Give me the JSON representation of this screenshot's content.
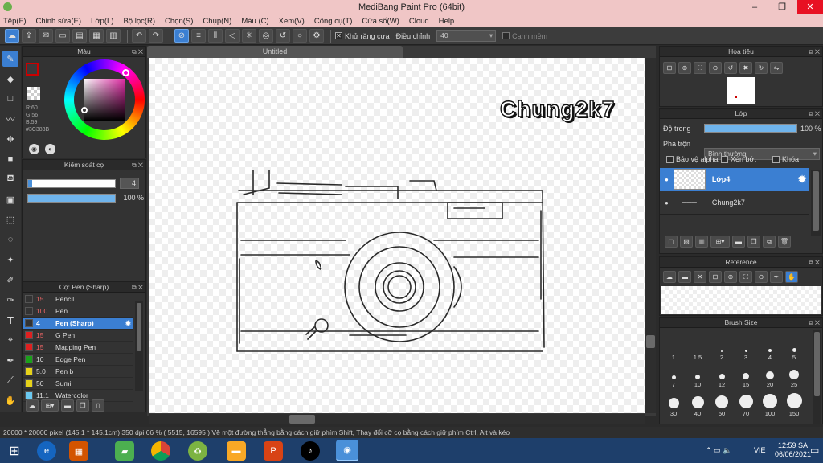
{
  "window": {
    "title": "MediBang Paint Pro (64bit)",
    "min": "–",
    "max": "❐",
    "close": "✕"
  },
  "menu": [
    "Tệp(F)",
    "Chỉnh sửa(E)",
    "Lớp(L)",
    "Bộ lọc(R)",
    "Chọn(S)",
    "Chụp(N)",
    "Màu (C)",
    "Xem(V)",
    "Công cụ(T)",
    "Cửa số(W)",
    "Cloud",
    "Help"
  ],
  "toolbar": {
    "antialias_label": "Khử răng cưa",
    "correction_label": "Điều chỉnh",
    "correction_value": "40",
    "edge_label": "Cạnh mềm"
  },
  "color_panel": {
    "title": "Màu",
    "r": "R:60",
    "g": "G:56",
    "b": "B:59",
    "hex": "#3C383B",
    "primary": "#3c383b",
    "secondary": "#ffffff"
  },
  "brush_control": {
    "title": "Kiểm soát cọ",
    "size": "4",
    "opacity": "100 %"
  },
  "brush_panel": {
    "title": "Cọ: Pen (Sharp)",
    "items": [
      {
        "size": "15",
        "name": "Pencil",
        "color": "#333333"
      },
      {
        "size": "100",
        "name": "Pen",
        "color": "#333333"
      },
      {
        "size": "4",
        "name": "Pen (Sharp)",
        "color": "#333333"
      },
      {
        "size": "15",
        "name": "G Pen",
        "color": "#e02020"
      },
      {
        "size": "15",
        "name": "Mapping Pen",
        "color": "#e02020"
      },
      {
        "size": "10",
        "name": "Edge Pen",
        "color": "#1aa01a"
      },
      {
        "size": "5.0",
        "name": "Pen b",
        "color": "#e6d21a"
      },
      {
        "size": "50",
        "name": "Sumi",
        "color": "#e6d21a"
      },
      {
        "size": "11.1",
        "name": "Watercolor",
        "color": "#6ac8f0"
      }
    ]
  },
  "document": {
    "tab": "Untitled",
    "canvas_text": "Chung2k7"
  },
  "navigator": {
    "title": "Hoa tiêu"
  },
  "layers_panel": {
    "title": "Lớp",
    "opacity_label": "Độ trong",
    "opacity_value": "100 %",
    "blend_label": "Pha trộn",
    "blend_value": "Bình thường",
    "protect_alpha": "Bảo vệ alpha",
    "clipping": "Xén bớt",
    "lock": "Khóa",
    "layers": [
      {
        "name": "Lớp4"
      },
      {
        "name": "Chung2k7"
      }
    ]
  },
  "reference": {
    "title": "Reference"
  },
  "brush_size": {
    "title": "Brush Size",
    "sizes": [
      "1",
      "1.5",
      "2",
      "3",
      "4",
      "5",
      "7",
      "10",
      "12",
      "15",
      "20",
      "25",
      "30",
      "40",
      "50",
      "70",
      "100",
      "150"
    ]
  },
  "status": {
    "text": "20000 * 20000 pixel  (145.1 * 145.1cm)  350 dpi  66 %  ( 5515, 16595 )  Vẽ một đường thẳng bằng cách giữ phím Shift, Thay đổi cỡ cọ bằng cách giữ phím Ctrl, Alt và kéo"
  },
  "taskbar": {
    "lang": "VIE",
    "time": "12:59 SA",
    "date": "06/06/2021"
  }
}
